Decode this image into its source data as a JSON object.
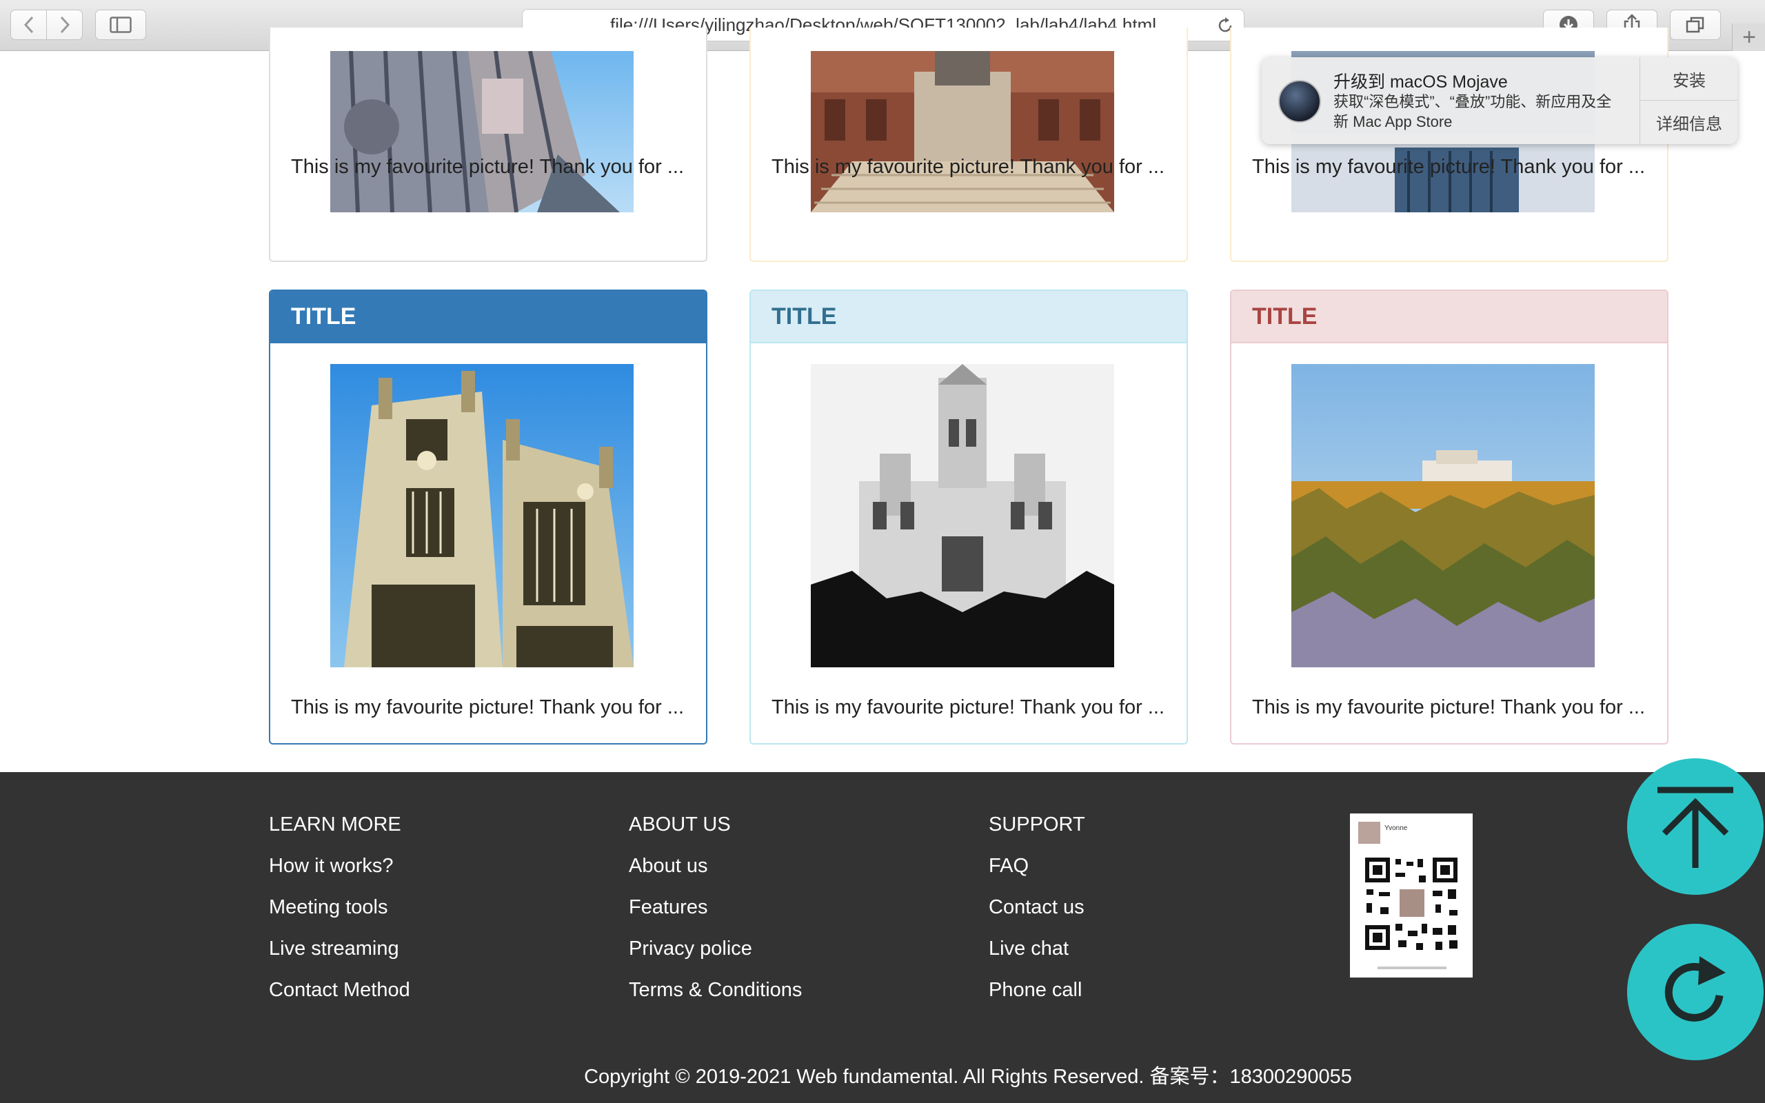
{
  "browser": {
    "url": "file:///Users/yilingzhao/Desktop/web/SOFT130002_lab/lab4/lab4.html"
  },
  "notification": {
    "title": "升级到 macOS Mojave",
    "body": "获取“深色模式”、“叠放”功能、新应用及全新 Mac App Store",
    "install_label": "安装",
    "details_label": "详细信息"
  },
  "cards_top": [
    {
      "caption": "This is my favourite picture! Thank you for ..."
    },
    {
      "caption": "This is my favourite picture! Thank you for ..."
    },
    {
      "caption": "This is my favourite picture! Thank you for ..."
    }
  ],
  "cards_bottom": [
    {
      "title": "TITLE",
      "caption": "This is my favourite picture! Thank you for ..."
    },
    {
      "title": "TITLE",
      "caption": "This is my favourite picture! Thank you for ..."
    },
    {
      "title": "TITLE",
      "caption": "This is my favourite picture! Thank you for ..."
    }
  ],
  "footer": {
    "learn_more": {
      "heading": "LEARN MORE",
      "links": [
        "How it works?",
        "Meeting tools",
        "Live streaming",
        "Contact Method"
      ]
    },
    "about_us": {
      "heading": "ABOUT US",
      "links": [
        "About us",
        "Features",
        "Privacy police",
        "Terms & Conditions"
      ]
    },
    "support": {
      "heading": "SUPPORT",
      "links": [
        "FAQ",
        "Contact us",
        "Live chat",
        "Phone call"
      ]
    },
    "qr_name": "Yvonne",
    "copyright": "Copyright © 2019-2021 Web fundamental. All Rights Reserved. 备案号：18300290055"
  },
  "colors": {
    "primary": "#337ab7",
    "info": "#d9edf7",
    "danger": "#f2dede",
    "footer_bg": "#333333",
    "fab": "#2bc4c6"
  }
}
